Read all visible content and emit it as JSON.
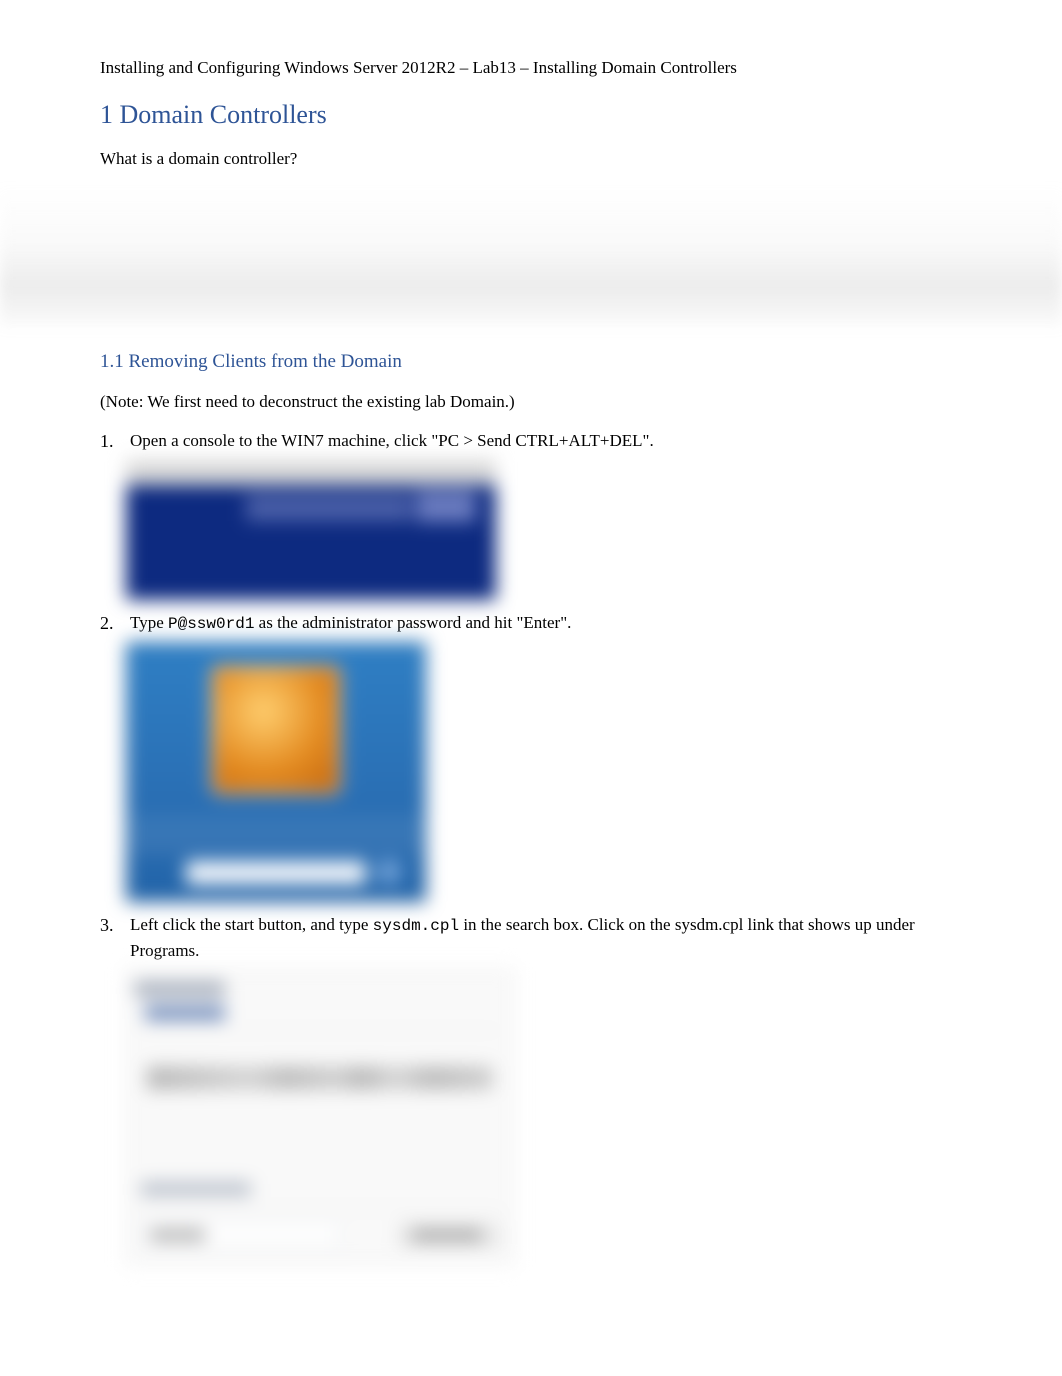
{
  "header": {
    "title": "Installing and Configuring Windows Server 2012R2 – Lab13 – Installing Domain Controllers"
  },
  "sections": {
    "h1": "1 Domain Controllers",
    "intro_q": "What is a domain controller?",
    "h2": "1.1 Removing Clients from the Domain",
    "note": "(Note: We first need to deconstruct the existing lab Domain.)"
  },
  "steps": [
    {
      "num": "1.",
      "text": "Open a console to the WIN7 machine, click \"PC > Send CTRL+ALT+DEL\"."
    },
    {
      "num": "2.",
      "pre": "Type ",
      "code": "P@ssw0rd1",
      "post": " as the administrator password and hit \"Enter\"."
    },
    {
      "num": "3.",
      "pre": "Left click the start button, and type  ",
      "code": "sysdm.cpl",
      "post": " in the search box. Click on the sysdm.cpl link that shows up under Programs."
    }
  ]
}
